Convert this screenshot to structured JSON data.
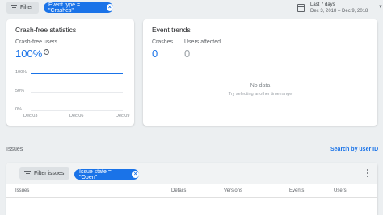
{
  "topbar": {
    "filter_label": "Filter",
    "active_filter_chip": "Event type = \"Crashes\"",
    "date_range_label": "Last 7 days",
    "date_range_value": "Dec 3, 2018 – Dec 9, 2018"
  },
  "crash_free_card": {
    "title": "Crash-free statistics",
    "metric_label": "Crash-free users",
    "metric_value": "100%",
    "chart_data": {
      "type": "line",
      "x": [
        "Dec 03",
        "Dec 06",
        "Dec 09"
      ],
      "y_ticks": [
        "100%",
        "50%",
        "0%"
      ],
      "series": [
        {
          "values": [
            100,
            100,
            100
          ]
        }
      ],
      "ylim": [
        0,
        100
      ]
    }
  },
  "event_trends_card": {
    "title": "Event trends",
    "crashes_label": "Crashes",
    "crashes_value": "0",
    "users_affected_label": "Users affected",
    "users_affected_value": "0",
    "empty_title": "No data",
    "empty_subtitle": "Try selecting another time range"
  },
  "issues_section": {
    "label": "Issues",
    "search_link": "Search by user ID",
    "filter_button": "Filter issues",
    "active_filter_chip": "Issue state = \"Open\"",
    "columns": [
      "Issues",
      "Details",
      "Versions",
      "Events",
      "Users"
    ]
  },
  "colors": {
    "accent": "#1a73e8",
    "background": "#eceff1"
  }
}
